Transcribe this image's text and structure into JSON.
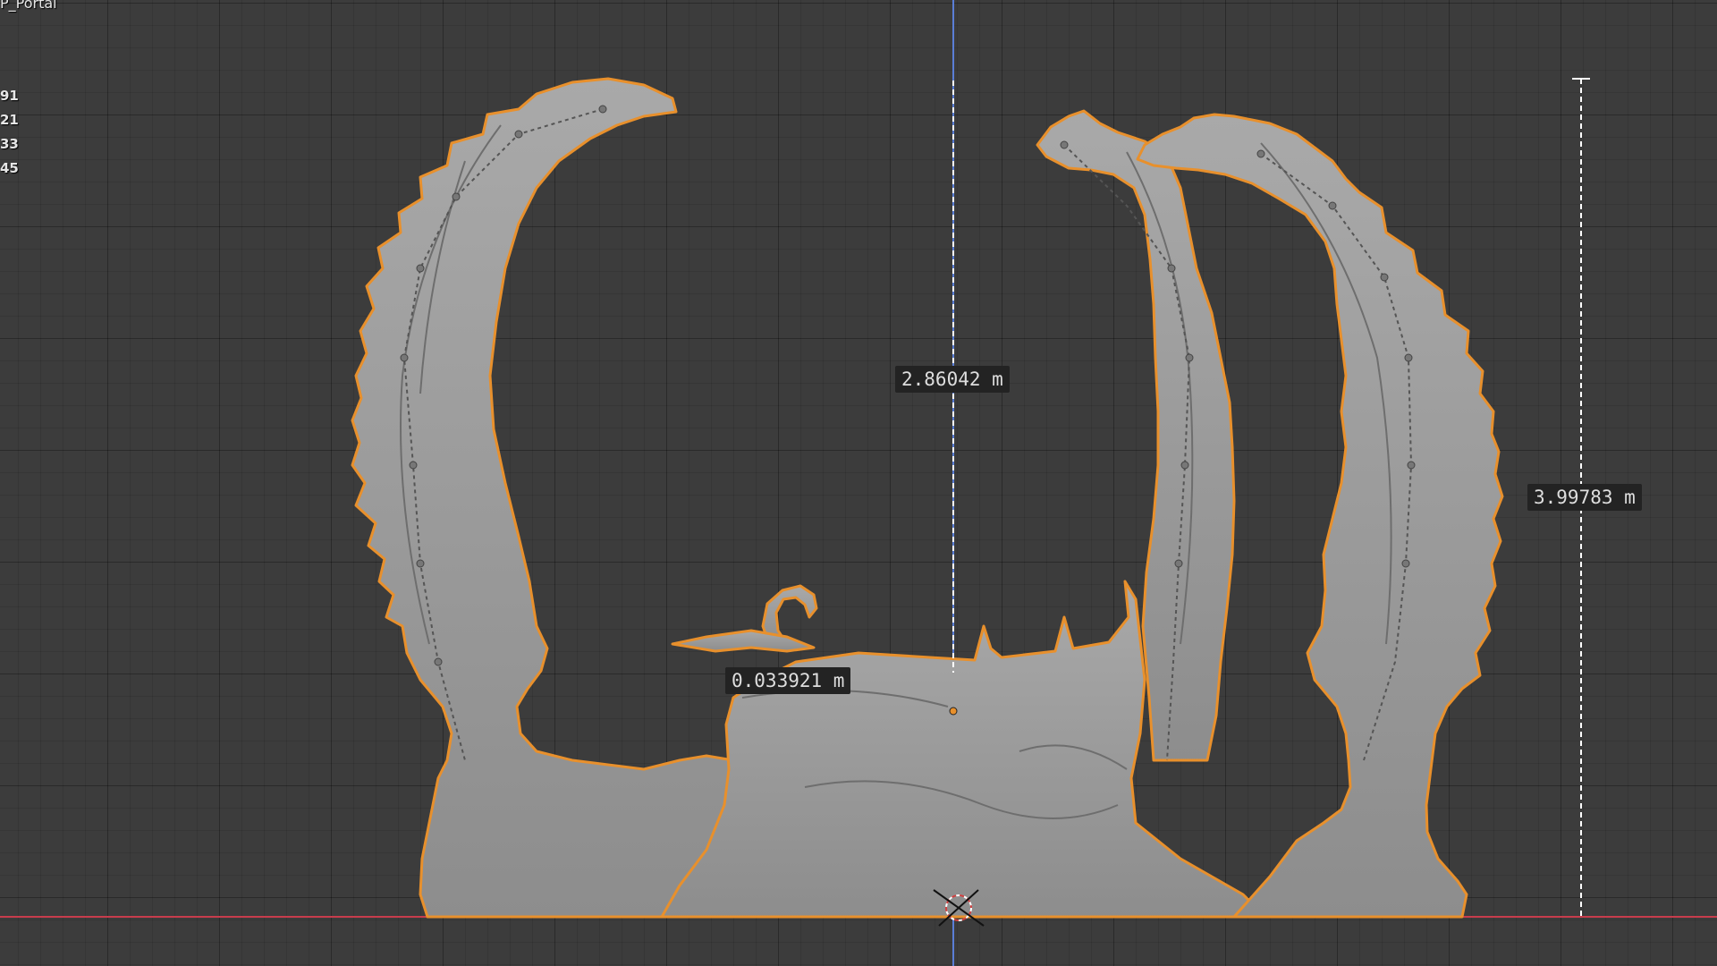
{
  "object_name": "P_Portal",
  "stats": [
    "91",
    "21",
    "33",
    "45"
  ],
  "measurements": {
    "center_height": "2.86042 m",
    "total_height": "3.99783 m",
    "gap": "0.033921 m"
  },
  "colors": {
    "grid_background": "#3c3c3c",
    "x_axis": "#c83c4c",
    "z_axis": "#5a7ed6",
    "selection_outline": "#e8902c",
    "mesh": "#9c9c9c"
  }
}
